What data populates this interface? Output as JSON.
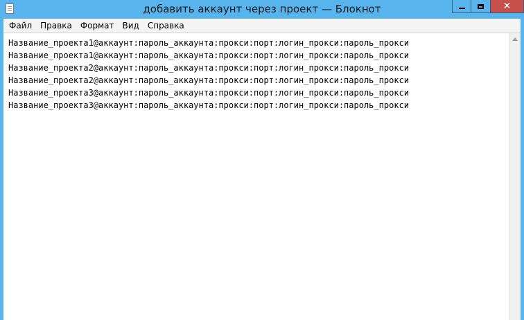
{
  "window": {
    "title": "добавить аккаунт через проект — Блокнот",
    "icon": "notepad-icon",
    "titlebar_color": "#58b4ec",
    "close_color": "#c7504a"
  },
  "menu": [
    {
      "label": "Файл"
    },
    {
      "label": "Правка"
    },
    {
      "label": "Формат"
    },
    {
      "label": "Вид"
    },
    {
      "label": "Справка"
    }
  ],
  "editor": {
    "lines": [
      "Название_проекта1@аккаунт:пароль_аккаунта:прокси:порт:логин_прокси:пароль_прокси",
      "Название_проекта1@аккаунт:пароль_аккаунта:прокси:порт:логин_прокси:пароль_прокси",
      "Название_проекта2@аккаунт:пароль_аккаунта:прокси:порт:логин_прокси:пароль_прокси",
      "Название_проекта2@аккаунт:пароль_аккаунта:прокси:порт:логин_прокси:пароль_прокси",
      "Название_проекта3@аккаунт:пароль_аккаунта:прокси:порт:логин_прокси:пароль_прокси",
      "Название_проекта3@аккаунт:пароль_аккаунта:прокси:порт:логин_прокси:пароль_прокси"
    ]
  }
}
